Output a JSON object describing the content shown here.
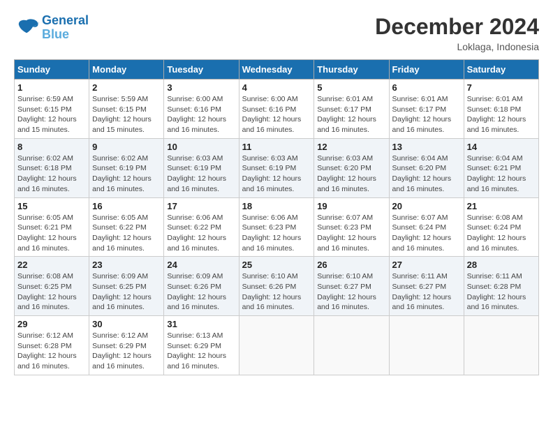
{
  "logo": {
    "line1": "General",
    "line2": "Blue"
  },
  "title": "December 2024",
  "location": "Loklaga, Indonesia",
  "weekdays": [
    "Sunday",
    "Monday",
    "Tuesday",
    "Wednesday",
    "Thursday",
    "Friday",
    "Saturday"
  ],
  "weeks": [
    [
      {
        "day": "1",
        "sunrise": "6:59 AM",
        "sunset": "6:15 PM",
        "daylight": "12 hours and 15 minutes."
      },
      {
        "day": "2",
        "sunrise": "5:59 AM",
        "sunset": "6:15 PM",
        "daylight": "12 hours and 15 minutes."
      },
      {
        "day": "3",
        "sunrise": "6:00 AM",
        "sunset": "6:16 PM",
        "daylight": "12 hours and 16 minutes."
      },
      {
        "day": "4",
        "sunrise": "6:00 AM",
        "sunset": "6:16 PM",
        "daylight": "12 hours and 16 minutes."
      },
      {
        "day": "5",
        "sunrise": "6:01 AM",
        "sunset": "6:17 PM",
        "daylight": "12 hours and 16 minutes."
      },
      {
        "day": "6",
        "sunrise": "6:01 AM",
        "sunset": "6:17 PM",
        "daylight": "12 hours and 16 minutes."
      },
      {
        "day": "7",
        "sunrise": "6:01 AM",
        "sunset": "6:18 PM",
        "daylight": "12 hours and 16 minutes."
      }
    ],
    [
      {
        "day": "8",
        "sunrise": "6:02 AM",
        "sunset": "6:18 PM",
        "daylight": "12 hours and 16 minutes."
      },
      {
        "day": "9",
        "sunrise": "6:02 AM",
        "sunset": "6:19 PM",
        "daylight": "12 hours and 16 minutes."
      },
      {
        "day": "10",
        "sunrise": "6:03 AM",
        "sunset": "6:19 PM",
        "daylight": "12 hours and 16 minutes."
      },
      {
        "day": "11",
        "sunrise": "6:03 AM",
        "sunset": "6:19 PM",
        "daylight": "12 hours and 16 minutes."
      },
      {
        "day": "12",
        "sunrise": "6:03 AM",
        "sunset": "6:20 PM",
        "daylight": "12 hours and 16 minutes."
      },
      {
        "day": "13",
        "sunrise": "6:04 AM",
        "sunset": "6:20 PM",
        "daylight": "12 hours and 16 minutes."
      },
      {
        "day": "14",
        "sunrise": "6:04 AM",
        "sunset": "6:21 PM",
        "daylight": "12 hours and 16 minutes."
      }
    ],
    [
      {
        "day": "15",
        "sunrise": "6:05 AM",
        "sunset": "6:21 PM",
        "daylight": "12 hours and 16 minutes."
      },
      {
        "day": "16",
        "sunrise": "6:05 AM",
        "sunset": "6:22 PM",
        "daylight": "12 hours and 16 minutes."
      },
      {
        "day": "17",
        "sunrise": "6:06 AM",
        "sunset": "6:22 PM",
        "daylight": "12 hours and 16 minutes."
      },
      {
        "day": "18",
        "sunrise": "6:06 AM",
        "sunset": "6:23 PM",
        "daylight": "12 hours and 16 minutes."
      },
      {
        "day": "19",
        "sunrise": "6:07 AM",
        "sunset": "6:23 PM",
        "daylight": "12 hours and 16 minutes."
      },
      {
        "day": "20",
        "sunrise": "6:07 AM",
        "sunset": "6:24 PM",
        "daylight": "12 hours and 16 minutes."
      },
      {
        "day": "21",
        "sunrise": "6:08 AM",
        "sunset": "6:24 PM",
        "daylight": "12 hours and 16 minutes."
      }
    ],
    [
      {
        "day": "22",
        "sunrise": "6:08 AM",
        "sunset": "6:25 PM",
        "daylight": "12 hours and 16 minutes."
      },
      {
        "day": "23",
        "sunrise": "6:09 AM",
        "sunset": "6:25 PM",
        "daylight": "12 hours and 16 minutes."
      },
      {
        "day": "24",
        "sunrise": "6:09 AM",
        "sunset": "6:26 PM",
        "daylight": "12 hours and 16 minutes."
      },
      {
        "day": "25",
        "sunrise": "6:10 AM",
        "sunset": "6:26 PM",
        "daylight": "12 hours and 16 minutes."
      },
      {
        "day": "26",
        "sunrise": "6:10 AM",
        "sunset": "6:27 PM",
        "daylight": "12 hours and 16 minutes."
      },
      {
        "day": "27",
        "sunrise": "6:11 AM",
        "sunset": "6:27 PM",
        "daylight": "12 hours and 16 minutes."
      },
      {
        "day": "28",
        "sunrise": "6:11 AM",
        "sunset": "6:28 PM",
        "daylight": "12 hours and 16 minutes."
      }
    ],
    [
      {
        "day": "29",
        "sunrise": "6:12 AM",
        "sunset": "6:28 PM",
        "daylight": "12 hours and 16 minutes."
      },
      {
        "day": "30",
        "sunrise": "6:12 AM",
        "sunset": "6:29 PM",
        "daylight": "12 hours and 16 minutes."
      },
      {
        "day": "31",
        "sunrise": "6:13 AM",
        "sunset": "6:29 PM",
        "daylight": "12 hours and 16 minutes."
      },
      null,
      null,
      null,
      null
    ]
  ]
}
